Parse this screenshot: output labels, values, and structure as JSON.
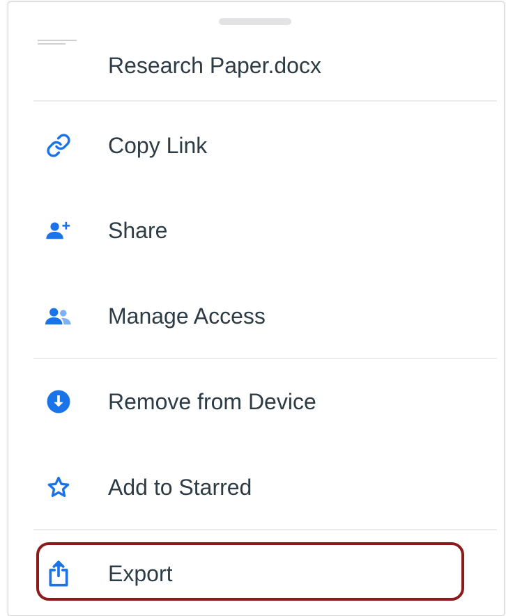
{
  "sheet": {
    "file_name": "Research Paper.docx"
  },
  "menu": {
    "items": [
      {
        "label": "Copy Link",
        "icon": "link-icon"
      },
      {
        "label": "Share",
        "icon": "add-person-icon"
      },
      {
        "label": "Manage Access",
        "icon": "people-icon"
      },
      {
        "label": "Remove from Device",
        "icon": "download-circle-icon"
      },
      {
        "label": "Add to Starred",
        "icon": "star-icon"
      },
      {
        "label": "Export",
        "icon": "share-export-icon"
      }
    ]
  },
  "colors": {
    "icon_blue": "#1a73e8",
    "text": "#2d3b45",
    "highlight": "#8b1a1a"
  }
}
